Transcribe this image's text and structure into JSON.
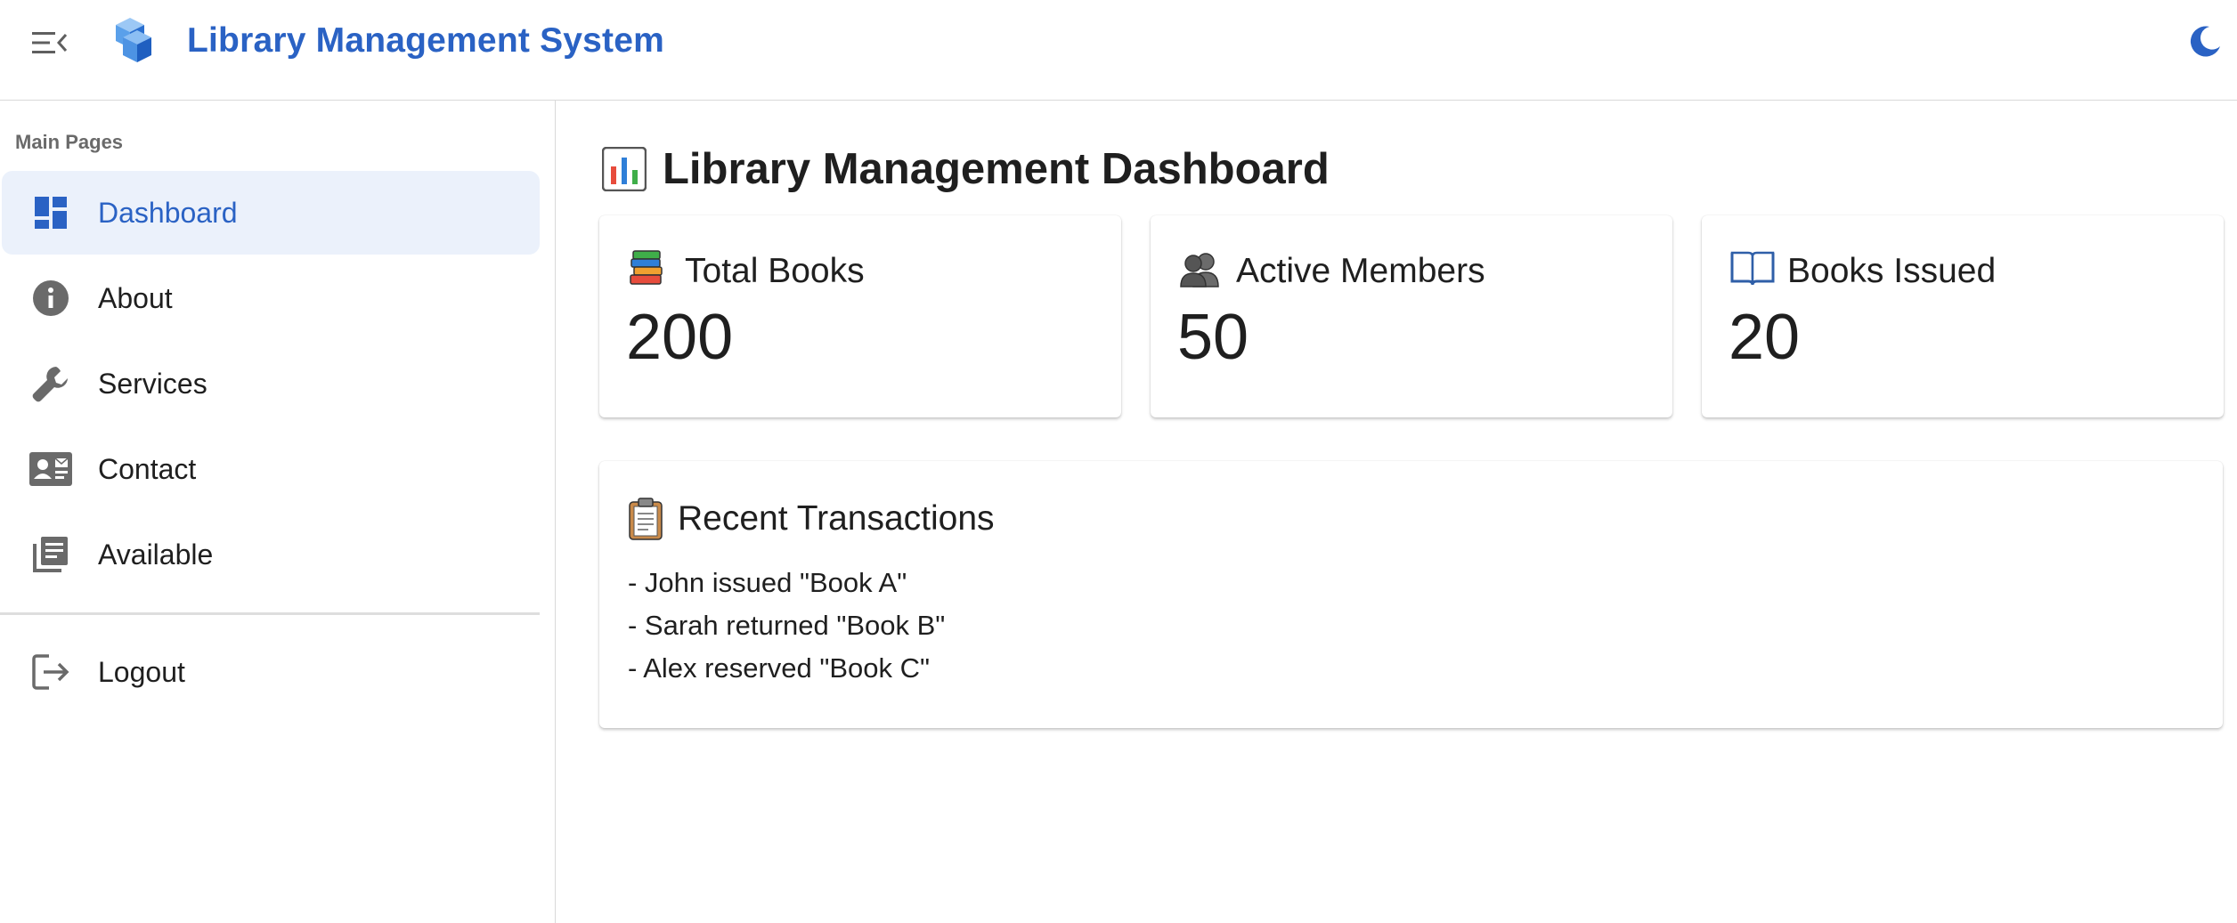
{
  "app": {
    "title": "Library Management System",
    "logo_icon": "cube-stack-logo",
    "menu_toggle_icon": "menu-collapse-icon",
    "theme_toggle_icon": "moon-icon",
    "accent_color": "#2a62c4"
  },
  "sidebar": {
    "section_label": "Main Pages",
    "items": [
      {
        "label": "Dashboard",
        "icon": "dashboard-icon",
        "active": true
      },
      {
        "label": "About",
        "icon": "info-icon",
        "active": false
      },
      {
        "label": "Services",
        "icon": "wrench-icon",
        "active": false
      },
      {
        "label": "Contact",
        "icon": "contact-card-icon",
        "active": false
      },
      {
        "label": "Available",
        "icon": "library-books-icon",
        "active": false
      }
    ],
    "logout": {
      "label": "Logout",
      "icon": "logout-icon"
    }
  },
  "main": {
    "page_title": "Library Management Dashboard",
    "page_title_icon": "bar-chart-emoji",
    "stats": [
      {
        "title": "Total Books",
        "value": "200",
        "icon": "books-emoji"
      },
      {
        "title": "Active Members",
        "value": "50",
        "icon": "people-emoji"
      },
      {
        "title": "Books Issued",
        "value": "20",
        "icon": "open-book-emoji"
      }
    ],
    "transactions": {
      "title": "Recent Transactions",
      "icon": "clipboard-emoji",
      "items": [
        "- John issued \"Book A\"",
        "- Sarah returned \"Book B\"",
        "- Alex reserved \"Book C\""
      ]
    }
  }
}
